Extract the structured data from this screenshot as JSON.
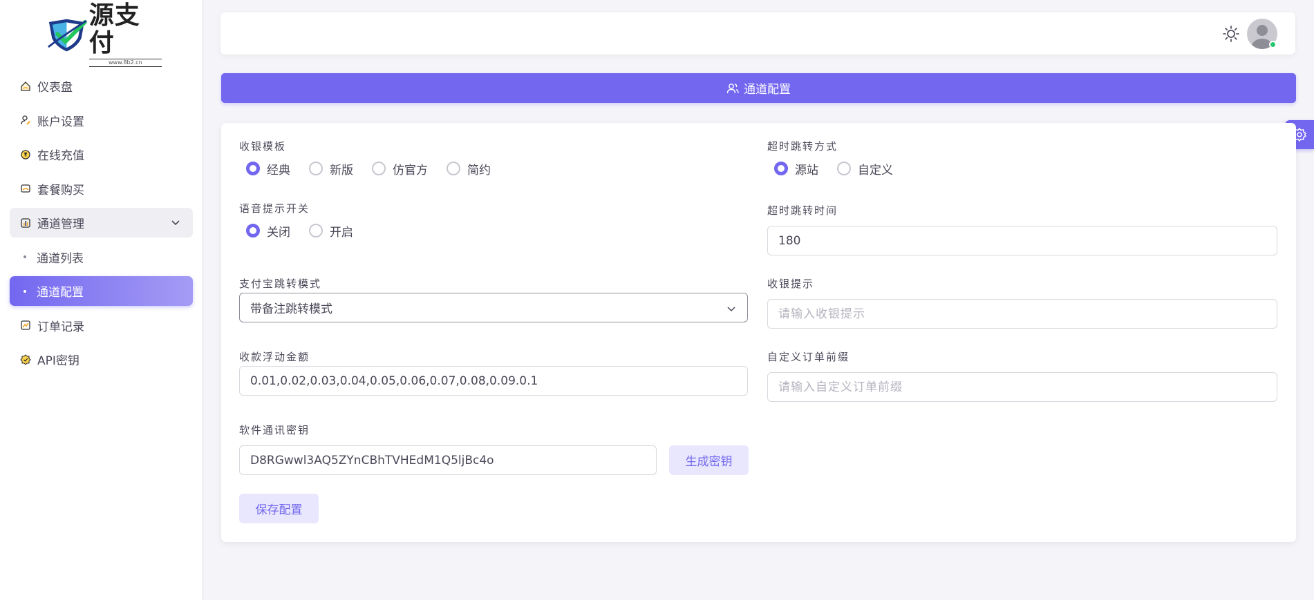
{
  "brand": {
    "name": "源支付",
    "sub": "www.8b2.cn",
    "accent": "#7367f0"
  },
  "sidebar": {
    "items": [
      {
        "label": "仪表盘",
        "icon": "home-icon"
      },
      {
        "label": "账户设置",
        "icon": "user-edit-icon"
      },
      {
        "label": "在线充值",
        "icon": "coin-icon"
      },
      {
        "label": "套餐购买",
        "icon": "package-icon"
      },
      {
        "label": "通道管理",
        "icon": "chart-bar-icon"
      },
      {
        "label": "通道列表"
      },
      {
        "label": "通道配置"
      },
      {
        "label": "订单记录",
        "icon": "chart-line-icon"
      },
      {
        "label": "API密钥",
        "icon": "key-badge-icon"
      }
    ]
  },
  "banner": {
    "title": "通道配置",
    "icon": "users-icon"
  },
  "form": {
    "template": {
      "label": "收银模板",
      "options": [
        "经典",
        "新版",
        "仿官方",
        "简约"
      ],
      "selected": "经典"
    },
    "timeout_mode": {
      "label": "超时跳转方式",
      "options": [
        "源站",
        "自定义"
      ],
      "selected": "源站"
    },
    "voice": {
      "label": "语音提示开关",
      "options": [
        "关闭",
        "开启"
      ],
      "selected": "关闭"
    },
    "timeout_time": {
      "label": "超时跳转时间",
      "value": "180"
    },
    "alipay_mode": {
      "label": "支付宝跳转模式",
      "value": "带备注跳转模式"
    },
    "cashier_tip": {
      "label": "收银提示",
      "placeholder": "请输入收银提示"
    },
    "float_amount": {
      "label": "收款浮动金额",
      "value": "0.01,0.02,0.03,0.04,0.05,0.06,0.07,0.08,0.09.0.1"
    },
    "order_prefix": {
      "label": "自定义订单前缀",
      "placeholder": "请输入自定义订单前缀"
    },
    "secret": {
      "label": "软件通讯密钥",
      "value": "D8RGwwl3AQ5ZYnCBhTVHEdM1Q5ljBc4o",
      "generate_label": "生成密钥"
    },
    "save_label": "保存配置"
  }
}
